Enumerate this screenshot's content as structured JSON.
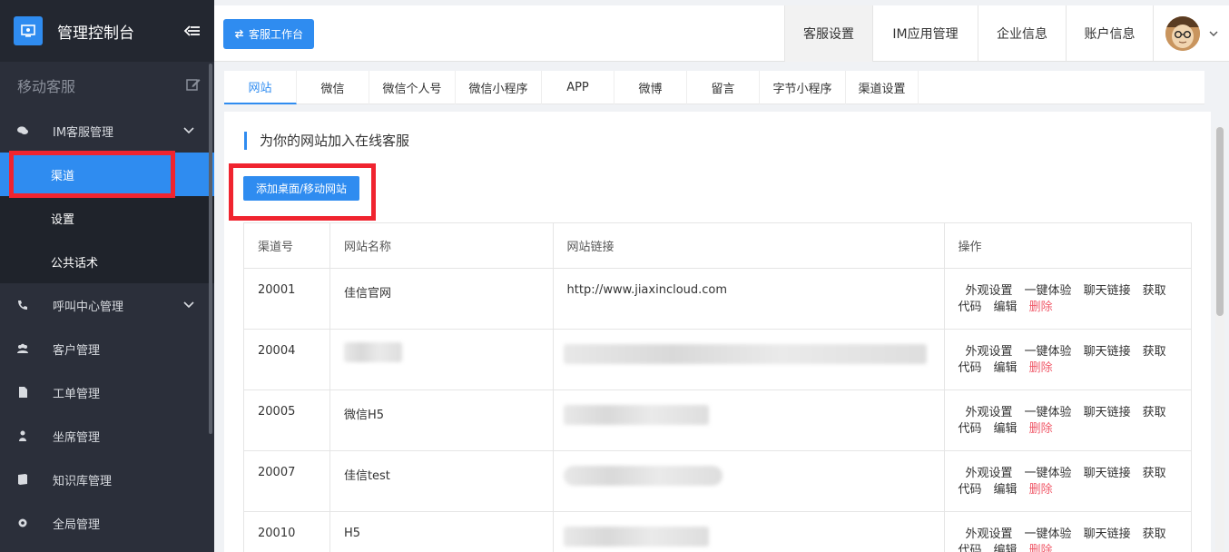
{
  "sidebar": {
    "brand_title": "管理控制台",
    "section_title": "移动客服",
    "im_group": "IM客服管理",
    "sub_items": [
      "渠道",
      "设置",
      "公共话术"
    ],
    "items": [
      "呼叫中心管理",
      "客户管理",
      "工单管理",
      "坐席管理",
      "知识库管理",
      "全局管理"
    ]
  },
  "header": {
    "workspace_btn": "客服工作台",
    "menu": [
      "客服设置",
      "IM应用管理",
      "企业信息",
      "账户信息"
    ]
  },
  "channel_tabs": [
    "网站",
    "微信",
    "微信个人号",
    "微信小程序",
    "APP",
    "微博",
    "留言",
    "字节小程序",
    "渠道设置"
  ],
  "panel": {
    "title": "为你的网站加入在线客服",
    "add_button": "添加桌面/移动网站"
  },
  "table": {
    "headers": [
      "渠道号",
      "网站名称",
      "网站链接",
      "操作"
    ],
    "ops": {
      "appearance": "外观设置",
      "try": "一键体验",
      "chat_link": "聊天链接",
      "get_code_1": "获取",
      "get_code_2": "代码",
      "edit": "编辑",
      "delete": "删除"
    },
    "rows": [
      {
        "id": "20001",
        "name": "佳信官网",
        "url": "http://www.jiaxincloud.com"
      },
      {
        "id": "20004",
        "name": "",
        "url": ""
      },
      {
        "id": "20005",
        "name": "微信H5",
        "url": ""
      },
      {
        "id": "20007",
        "name": "佳信test",
        "url": ""
      },
      {
        "id": "20010",
        "name": "H5",
        "url": ""
      }
    ]
  },
  "colors": {
    "accent": "#2f8cf0",
    "sidebar_bg": "#2b2f3a",
    "highlight": "#f0242f",
    "danger": "#f05a6a"
  }
}
